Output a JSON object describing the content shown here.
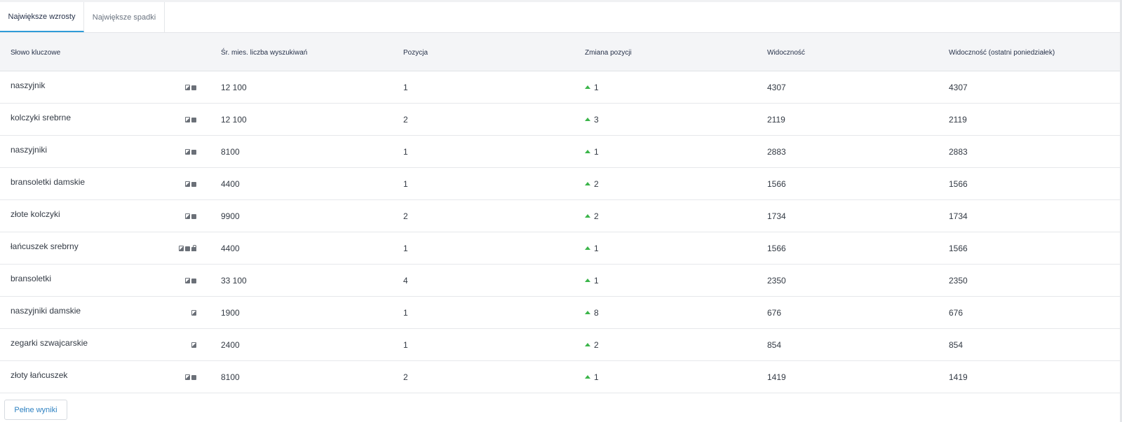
{
  "tabs": [
    {
      "label": "Największe wzrosty",
      "active": true
    },
    {
      "label": "Największe spadki",
      "active": false
    }
  ],
  "columns": {
    "keyword": "Słowo kluczowe",
    "volume": "Śr. mies. liczba wyszukiwań",
    "position": "Pozycja",
    "position_change": "Zmiana pozycji",
    "visibility": "Widoczność",
    "visibility_last_monday": "Widoczność (ostatni poniedziałek)"
  },
  "rows": [
    {
      "keyword": "naszyjnik",
      "features": [
        "images-icon",
        "news-icon"
      ],
      "volume": "12 100",
      "position": "1",
      "change": "1",
      "visibility": "4307",
      "visibility_last": "4307"
    },
    {
      "keyword": "kolczyki srebrne",
      "features": [
        "images-icon",
        "news-icon"
      ],
      "volume": "12 100",
      "position": "2",
      "change": "3",
      "visibility": "2119",
      "visibility_last": "2119"
    },
    {
      "keyword": "naszyjniki",
      "features": [
        "images-icon",
        "news-icon"
      ],
      "volume": "8100",
      "position": "1",
      "change": "1",
      "visibility": "2883",
      "visibility_last": "2883"
    },
    {
      "keyword": "bransoletki damskie",
      "features": [
        "images-icon",
        "news-icon"
      ],
      "volume": "4400",
      "position": "1",
      "change": "2",
      "visibility": "1566",
      "visibility_last": "1566"
    },
    {
      "keyword": "złote kolczyki",
      "features": [
        "images-icon",
        "news-icon"
      ],
      "volume": "9900",
      "position": "2",
      "change": "2",
      "visibility": "1734",
      "visibility_last": "1734"
    },
    {
      "keyword": "łańcuszek srebrny",
      "features": [
        "images-icon",
        "news-icon",
        "shopping-icon"
      ],
      "volume": "4400",
      "position": "1",
      "change": "1",
      "visibility": "1566",
      "visibility_last": "1566"
    },
    {
      "keyword": "bransoletki",
      "features": [
        "images-icon",
        "news-icon"
      ],
      "volume": "33 100",
      "position": "4",
      "change": "1",
      "visibility": "2350",
      "visibility_last": "2350"
    },
    {
      "keyword": "naszyjniki damskie",
      "features": [
        "images-icon"
      ],
      "volume": "1900",
      "position": "1",
      "change": "8",
      "visibility": "676",
      "visibility_last": "676"
    },
    {
      "keyword": "zegarki szwajcarskie",
      "features": [
        "images-icon"
      ],
      "volume": "2400",
      "position": "1",
      "change": "2",
      "visibility": "854",
      "visibility_last": "854"
    },
    {
      "keyword": "złoty łańcuszek",
      "features": [
        "images-icon",
        "news-icon"
      ],
      "volume": "8100",
      "position": "2",
      "change": "1",
      "visibility": "1419",
      "visibility_last": "1419"
    }
  ],
  "footer": {
    "full_results_label": "Pełne wyniki"
  },
  "colors": {
    "accent": "#2f9bd8",
    "increase": "#3bb54a",
    "link": "#2f82c2"
  }
}
